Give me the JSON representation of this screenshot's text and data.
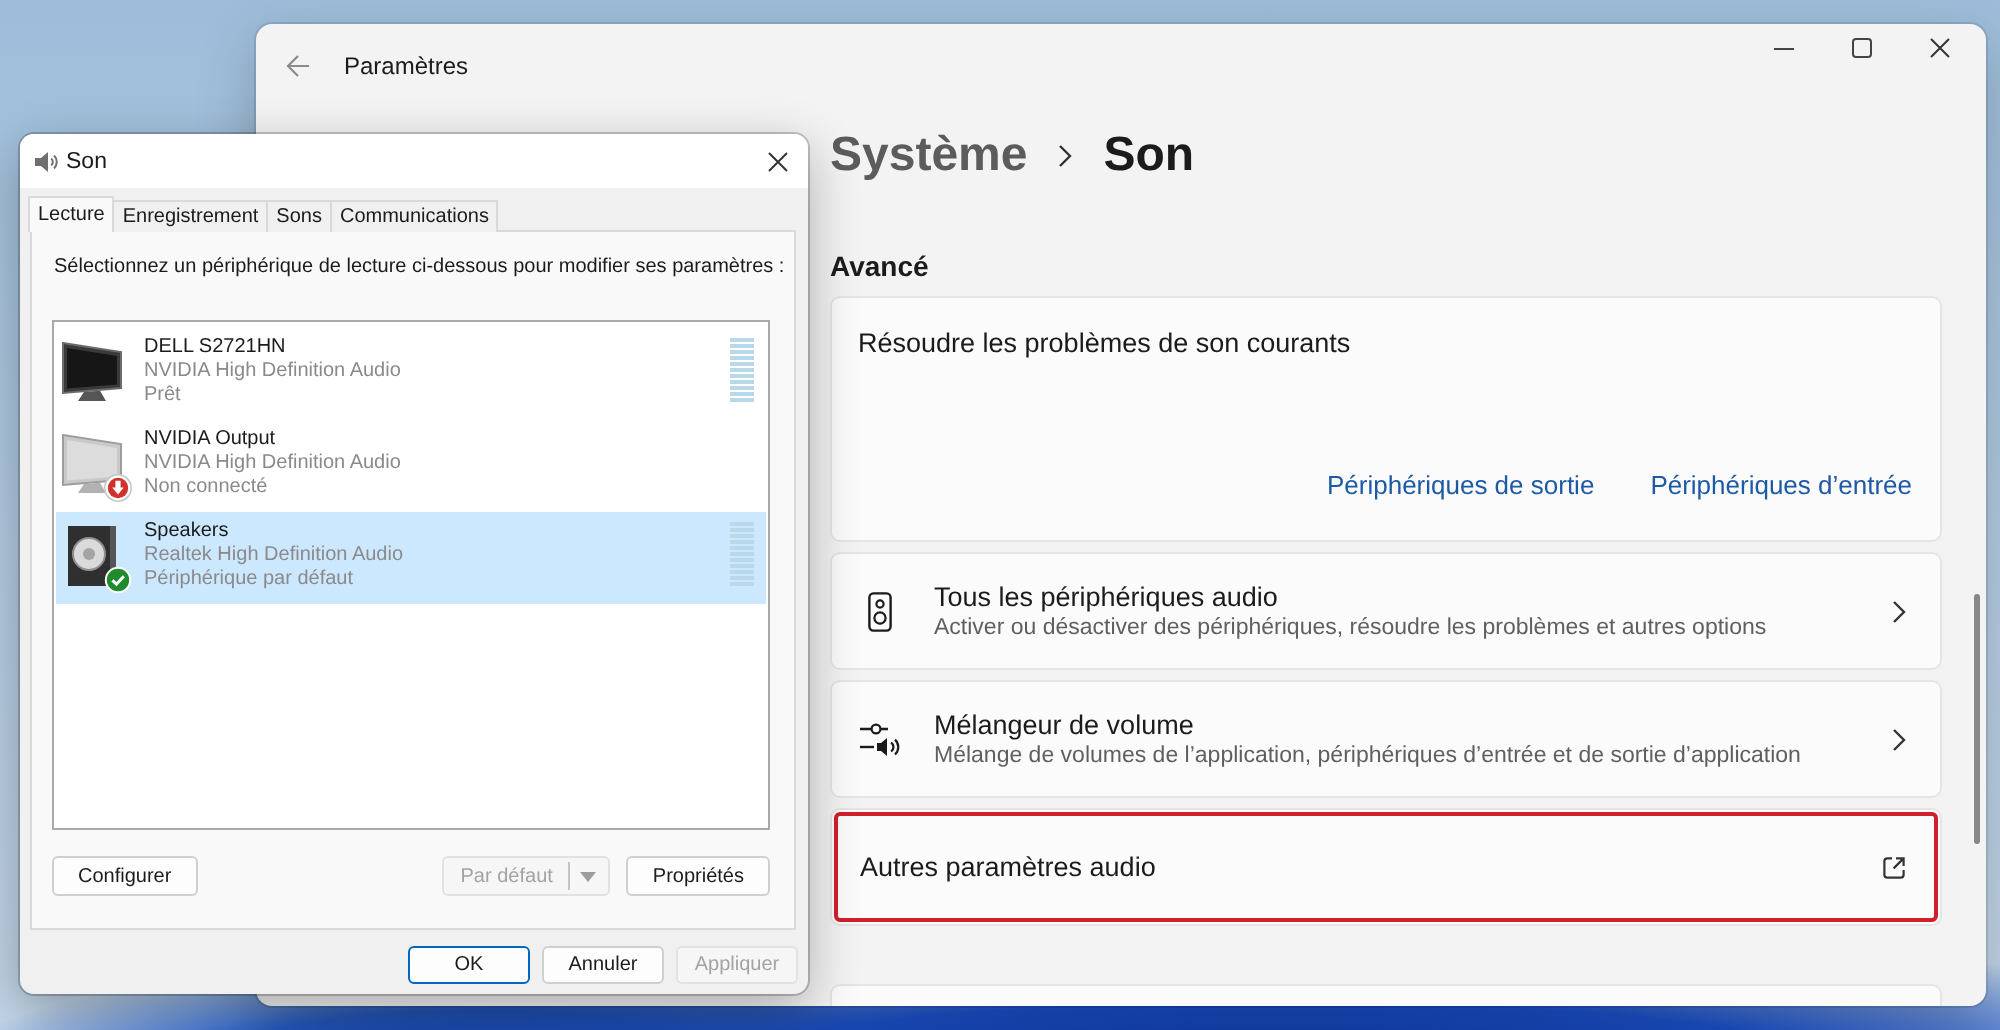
{
  "settings_window": {
    "title": "Paramètres",
    "breadcrumb": {
      "parent": "Système",
      "current": "Son"
    },
    "section_title": "Avancé",
    "troubleshoot_card": {
      "title": "Résoudre les problèmes de son courants",
      "links": [
        "Périphériques de sortie",
        "Périphériques d’entrée"
      ]
    },
    "rows": [
      {
        "kind": "devices",
        "title": "Tous les périphériques audio",
        "subtitle": "Activer ou désactiver des périphériques, résoudre les problèmes et autres options",
        "external": false,
        "highlighted": false
      },
      {
        "kind": "mixer",
        "title": "Mélangeur de volume",
        "subtitle": "Mélange de volumes de l’application, périphériques d’entrée et de sortie d’application",
        "external": false,
        "highlighted": false
      },
      {
        "kind": "plain",
        "title": "Autres paramètres audio",
        "external": true,
        "highlighted": true
      }
    ]
  },
  "sound_dialog": {
    "title": "Son",
    "tabs": [
      {
        "label": "Lecture",
        "selected": true
      },
      {
        "label": "Enregistrement",
        "selected": false
      },
      {
        "label": "Sons",
        "selected": false
      },
      {
        "label": "Communications",
        "selected": false
      }
    ],
    "instruction": "Sélectionnez un périphérique de lecture ci-dessous pour modifier ses paramètres :",
    "devices": [
      {
        "kind": "monitor",
        "name": "DELL S2721HN",
        "driver": "NVIDIA High Definition Audio",
        "status": "Prêt",
        "connected": true,
        "default": false,
        "selected": false,
        "level": 0
      },
      {
        "kind": "monitor",
        "name": "NVIDIA Output",
        "driver": "NVIDIA High Definition Audio",
        "status": "Non connecté",
        "connected": false,
        "default": false,
        "selected": false
      },
      {
        "kind": "speakers",
        "name": "Speakers",
        "driver": "Realtek High Definition Audio",
        "status": "Périphérique par défaut",
        "connected": true,
        "default": true,
        "selected": true,
        "level": 0
      }
    ],
    "device_buttons": [
      {
        "kind": "button",
        "label": "Configurer",
        "disabled": false
      },
      {
        "kind": "split",
        "label": "Par défaut",
        "disabled": true
      },
      {
        "kind": "button",
        "label": "Propriétés",
        "disabled": false
      }
    ],
    "footer_buttons": [
      {
        "label": "OK",
        "default": true,
        "disabled": false
      },
      {
        "label": "Annuler",
        "default": false,
        "disabled": false
      },
      {
        "label": "Appliquer",
        "default": false,
        "disabled": true
      }
    ]
  }
}
